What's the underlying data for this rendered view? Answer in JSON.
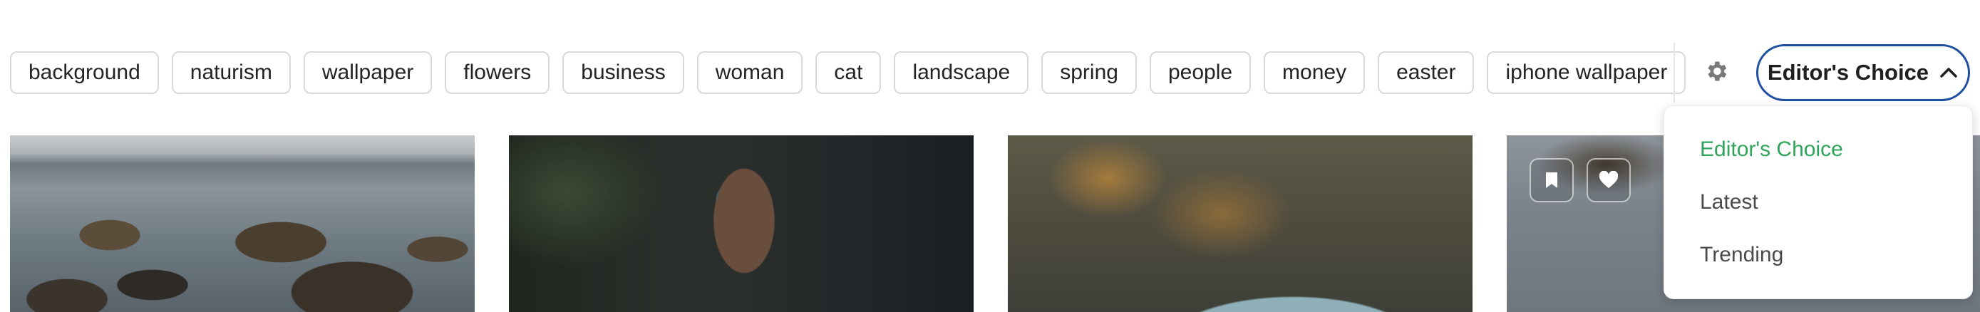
{
  "tags": [
    "background",
    "naturism",
    "wallpaper",
    "flowers",
    "business",
    "woman",
    "cat",
    "landscape",
    "spring",
    "people",
    "money",
    "easter",
    "iphone wallpaper"
  ],
  "sort": {
    "label": "Editor's Choice",
    "options": [
      "Editor's Choice",
      "Latest",
      "Trending"
    ],
    "selected": "Editor's Choice"
  },
  "icons": {
    "settings": "gear-icon",
    "sort_toggle": "chevron-up-icon",
    "bookmark": "bookmark-icon",
    "like": "heart-icon"
  },
  "colors": {
    "accent_border": "#1f4fa0",
    "selected_option": "#2ea55b",
    "tag_border": "#d9d9d9"
  }
}
